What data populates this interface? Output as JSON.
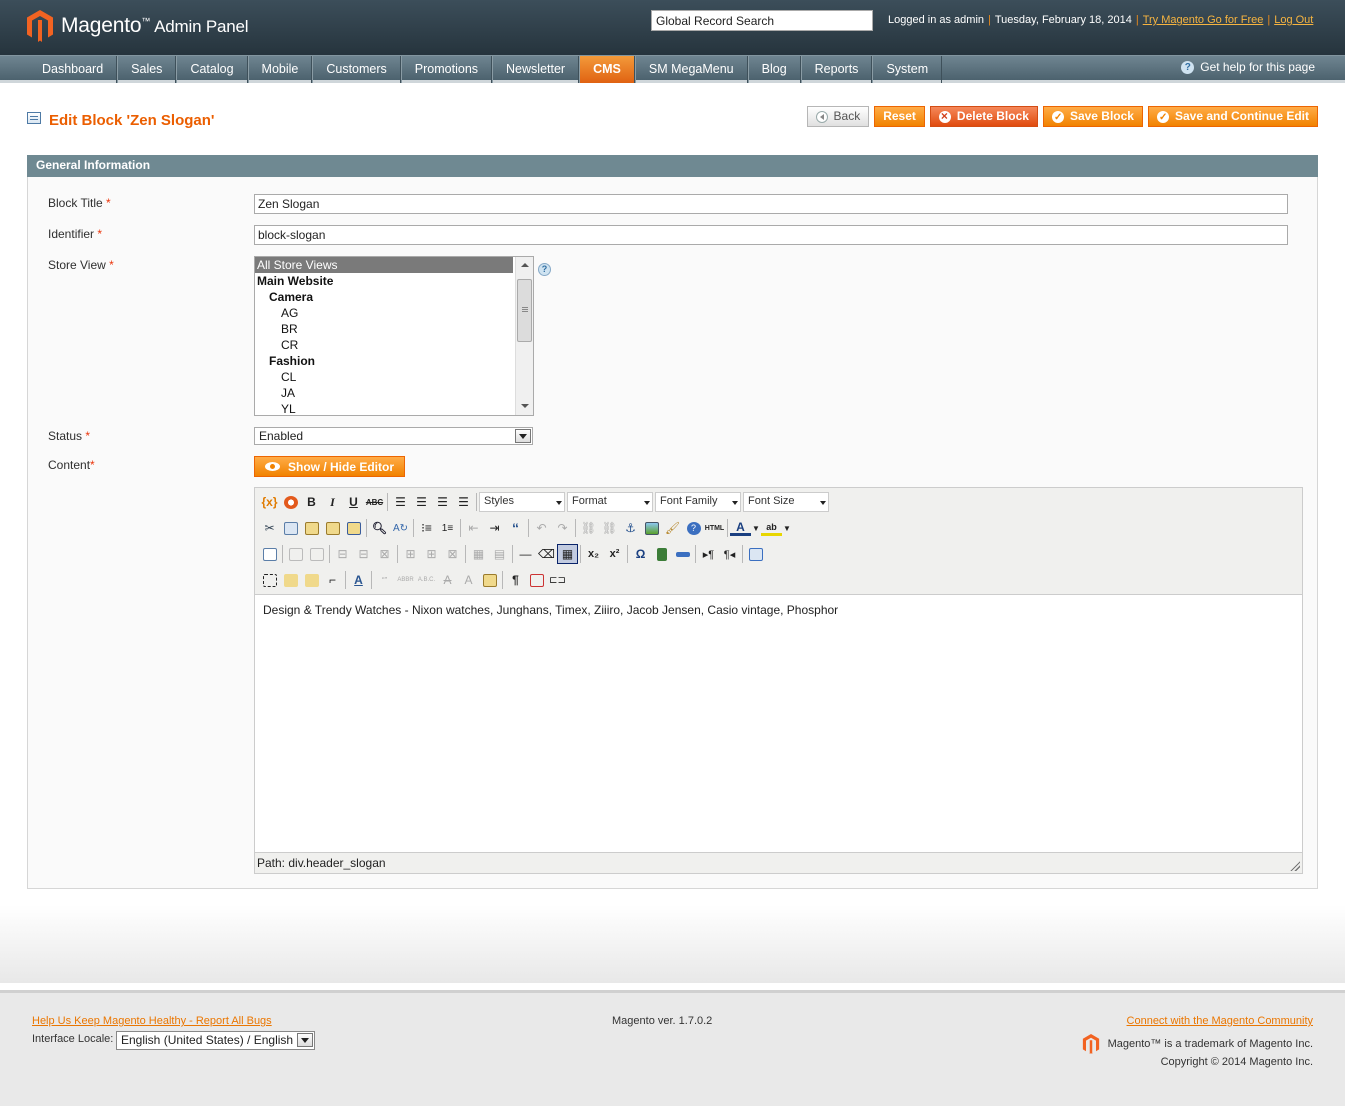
{
  "header": {
    "logo_text": "Magento",
    "logo_tm": "™",
    "logo_suffix": "Admin Panel",
    "search_value": "Global Record Search",
    "logged_in": "Logged in as admin",
    "date": "Tuesday, February 18, 2014",
    "try_link": "Try Magento Go for Free",
    "logout_link": "Log Out"
  },
  "nav": {
    "items": [
      "Dashboard",
      "Sales",
      "Catalog",
      "Mobile",
      "Customers",
      "Promotions",
      "Newsletter",
      "CMS",
      "SM MegaMenu",
      "Blog",
      "Reports",
      "System"
    ],
    "active": "CMS",
    "help": "Get help for this page"
  },
  "page": {
    "title": "Edit Block 'Zen Slogan'",
    "buttons": {
      "back": "Back",
      "reset": "Reset",
      "delete": "Delete Block",
      "save": "Save Block",
      "save_continue": "Save and Continue Edit"
    }
  },
  "form": {
    "section_title": "General Information",
    "block_title_label": "Block Title",
    "block_title_value": "Zen Slogan",
    "identifier_label": "Identifier",
    "identifier_value": "block-slogan",
    "store_view_label": "Store View",
    "store_views": [
      {
        "label": "All Store Views",
        "kind": "sel"
      },
      {
        "label": "Main Website",
        "kind": "grp"
      },
      {
        "label": "Camera",
        "kind": "grp l1"
      },
      {
        "label": "AG",
        "kind": "l2"
      },
      {
        "label": "BR",
        "kind": "l2"
      },
      {
        "label": "CR",
        "kind": "l2"
      },
      {
        "label": "Fashion",
        "kind": "grp l1"
      },
      {
        "label": "CL",
        "kind": "l2"
      },
      {
        "label": "JA",
        "kind": "l2"
      },
      {
        "label": "YL",
        "kind": "l2"
      }
    ],
    "status_label": "Status",
    "status_value": "Enabled",
    "content_label": "Content",
    "required_mark": "*",
    "show_hide_editor": "Show / Hide Editor"
  },
  "editor": {
    "dropdowns": {
      "styles": "Styles",
      "format": "Format",
      "font_family": "Font Family",
      "font_size": "Font Size"
    },
    "content": "Design & Trendy Watches - Nixon watches, Junghans, Timex, Ziiiro, Jacob Jensen, Casio vintage, Phosphor",
    "path": "Path: div.header_slogan"
  },
  "footer": {
    "report_link": "Help Us Keep Magento Healthy - Report All Bugs",
    "locale_label": "Interface Locale:",
    "locale_value": "English (United States) / English",
    "version": "Magento ver. 1.7.0.2",
    "community_link": "Connect with the Magento Community",
    "trademark": "Magento™ is a trademark of Magento Inc.",
    "copyright": "Copyright © 2014 Magento Inc."
  },
  "colors": {
    "accent": "#eb5e00",
    "button": "#f18200",
    "nav": "#5d737e",
    "header": "#2e3e48"
  }
}
